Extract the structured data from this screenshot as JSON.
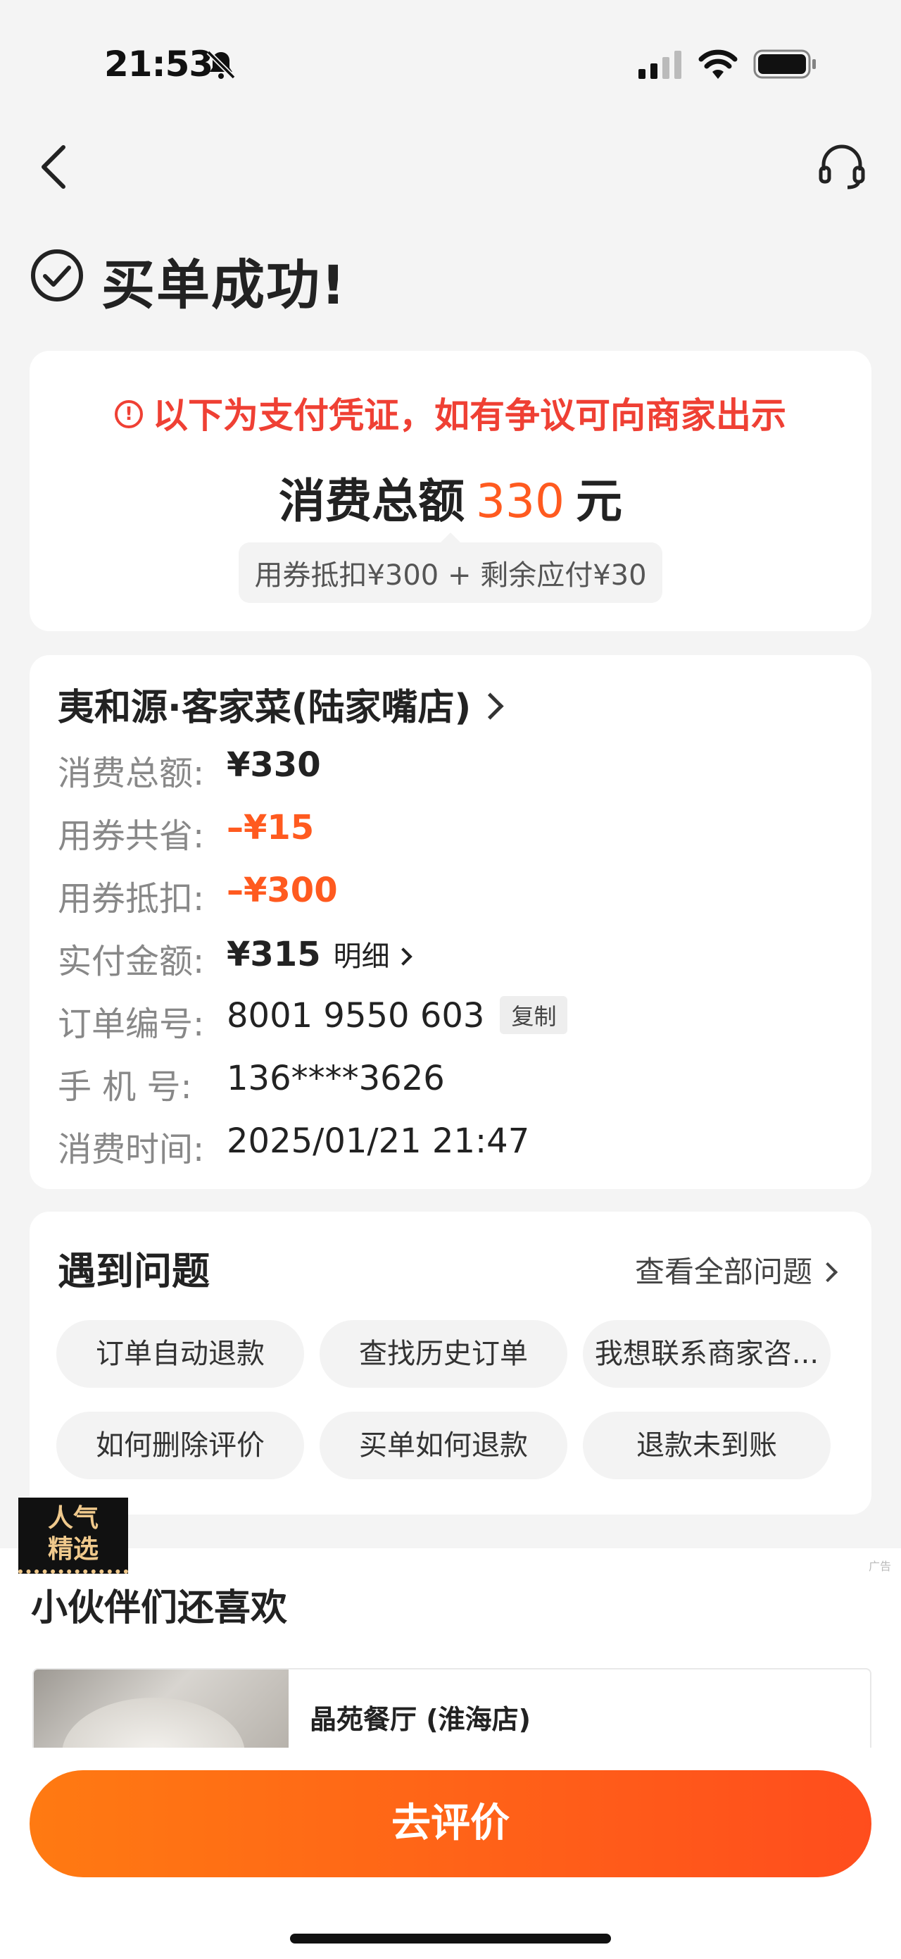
{
  "status_bar": {
    "time": "21:53"
  },
  "header": {
    "title": "买单成功!"
  },
  "voucher": {
    "notice": "以下为支付凭证，如有争议可向商家出示",
    "total_label": "消费总额",
    "total_amount": "330",
    "total_unit": "元",
    "breakdown": "用券抵扣¥300 + 剩余应付¥30"
  },
  "order": {
    "store_name": "夷和源·客家菜(陆家嘴店)",
    "rows": [
      {
        "label": "消费总额:",
        "value": "¥330"
      },
      {
        "label": "用券共省:",
        "value": "–¥15"
      },
      {
        "label": "用券抵扣:",
        "value": "–¥300"
      },
      {
        "label": "实付金额:",
        "value": "¥315"
      },
      {
        "label": "订单编号:",
        "value": "8001 9550 603"
      },
      {
        "label": "手 机 号:",
        "value": "136****3626"
      },
      {
        "label": "消费时间:",
        "value": "2025/01/21 21:47"
      }
    ],
    "detail_label": "明细",
    "copy_label": "复制"
  },
  "problems": {
    "title": "遇到问题",
    "view_all": "查看全部问题",
    "chips": [
      "订单自动退款",
      "查找历史订单",
      "我想联系商家咨...",
      "如何删除评价",
      "买单如何退款",
      "退款未到账"
    ]
  },
  "recommend": {
    "ad_mark": "广告",
    "title": "小伙伴们还喜欢",
    "badge_line1": "人气",
    "badge_line2": "精选",
    "item_name": "晶苑餐厅 (淮海店)"
  },
  "footer": {
    "review_button": "去评价"
  },
  "colors": {
    "accent": "#ff5a1f",
    "warning": "#ef4034",
    "button": "#ff6a16"
  },
  "icons": [
    "bell-slash-icon",
    "signal-icon",
    "wifi-icon",
    "battery-icon",
    "back-icon",
    "customer-service-icon",
    "check-circle-icon",
    "warning-icon",
    "chevron-right-icon"
  ]
}
